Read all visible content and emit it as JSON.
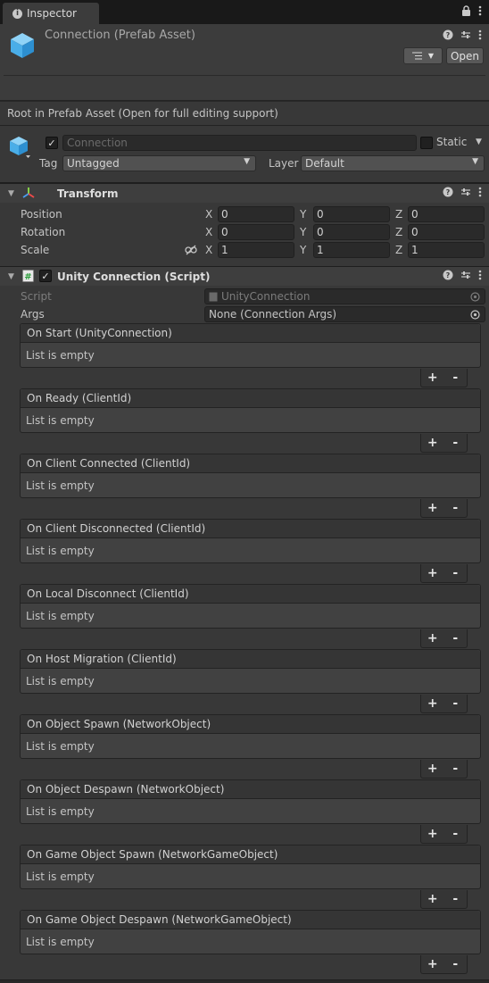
{
  "tab": {
    "label": "Inspector"
  },
  "header": {
    "title": "Connection (Prefab Asset)",
    "open_label": "Open"
  },
  "root_notice": "Root in Prefab Asset (Open for full editing support)",
  "gameobject": {
    "name_placeholder": "Connection",
    "static_label": "Static",
    "tag_label": "Tag",
    "tag_value": "Untagged",
    "layer_label": "Layer",
    "layer_value": "Default"
  },
  "transform": {
    "title": "Transform",
    "rows": [
      {
        "label": "Position",
        "x": "0",
        "y": "0",
        "z": "0"
      },
      {
        "label": "Rotation",
        "x": "0",
        "y": "0",
        "z": "0"
      },
      {
        "label": "Scale",
        "x": "1",
        "y": "1",
        "z": "1"
      }
    ],
    "axis": {
      "x": "X",
      "y": "Y",
      "z": "Z"
    }
  },
  "component": {
    "title": "Unity Connection (Script)",
    "script_label": "Script",
    "script_value": "UnityConnection",
    "args_label": "Args",
    "args_value": "None (Connection Args)"
  },
  "events": [
    {
      "title": "On Start (UnityConnection)",
      "body": "List is empty"
    },
    {
      "title": "On Ready (ClientId)",
      "body": "List is empty"
    },
    {
      "title": "On Client Connected (ClientId)",
      "body": "List is empty"
    },
    {
      "title": "On Client Disconnected (ClientId)",
      "body": "List is empty"
    },
    {
      "title": "On Local Disconnect (ClientId)",
      "body": "List is empty"
    },
    {
      "title": "On Host Migration (ClientId)",
      "body": "List is empty"
    },
    {
      "title": "On Object Spawn (NetworkObject)",
      "body": "List is empty"
    },
    {
      "title": "On Object Despawn (NetworkObject)",
      "body": "List is empty"
    },
    {
      "title": "On Game Object Spawn (NetworkGameObject)",
      "body": "List is empty"
    },
    {
      "title": "On Game Object Despawn (NetworkGameObject)",
      "body": "List is empty"
    }
  ],
  "list_controls": {
    "plus": "+",
    "minus": "-"
  }
}
